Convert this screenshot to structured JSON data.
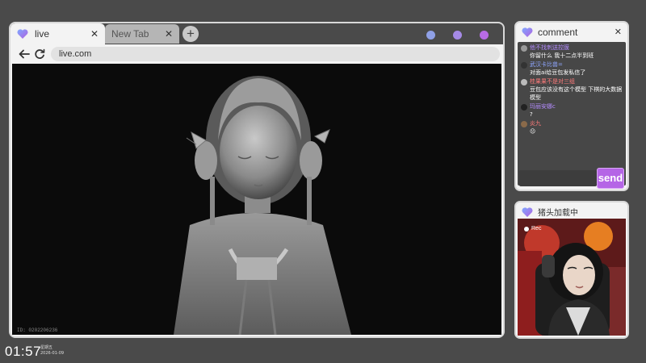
{
  "browser": {
    "tabs": [
      {
        "label": "live",
        "active": true
      },
      {
        "label": "New Tab",
        "active": false
      }
    ],
    "url": "live.com",
    "dots_colors": [
      "#8fa0e6",
      "#a58ae6",
      "#b86be6"
    ],
    "video_id": "ID: 0202206236"
  },
  "clock": {
    "time": "01:57",
    "line1": "星期五",
    "line2": "2026-01-09"
  },
  "comment_panel": {
    "title": "comment",
    "messages": [
      {
        "name": "他不找刺送控膜",
        "name_color": "#b48cff",
        "avatar": "#9a9a9a",
        "text": "你留什么 我十二点半到班"
      },
      {
        "name": "武汉卡比兽=",
        "name_color": "#8fa6ff",
        "avatar": "#333333",
        "text": "对面ai给豆包发私信了"
      },
      {
        "name": "桂果果不是对三组",
        "name_color": "#ff7b7b",
        "avatar": "#bbbbbb",
        "text": "豆包应该没有这个模型 下棋的大数据模型"
      },
      {
        "name": "玛丽安娜c",
        "name_color": "#b48cff",
        "avatar": "#222222",
        "text": "?"
      },
      {
        "name": "炎九",
        "name_color": "#ff7b7b",
        "avatar": "#8a6a4a",
        "text": "😐"
      }
    ],
    "send_label": "send"
  },
  "cam_panel": {
    "title": "猪头加载中",
    "rec_label": "Rec"
  },
  "icons": {
    "heart": "heart-icon",
    "back": "back-arrow-icon",
    "reload": "reload-icon",
    "close": "close-icon",
    "add": "plus-icon",
    "cursor": "mouse-cursor-icon"
  },
  "colors": {
    "accent_purple": "#b565e6",
    "frame_bg": "#4a4a4a"
  }
}
